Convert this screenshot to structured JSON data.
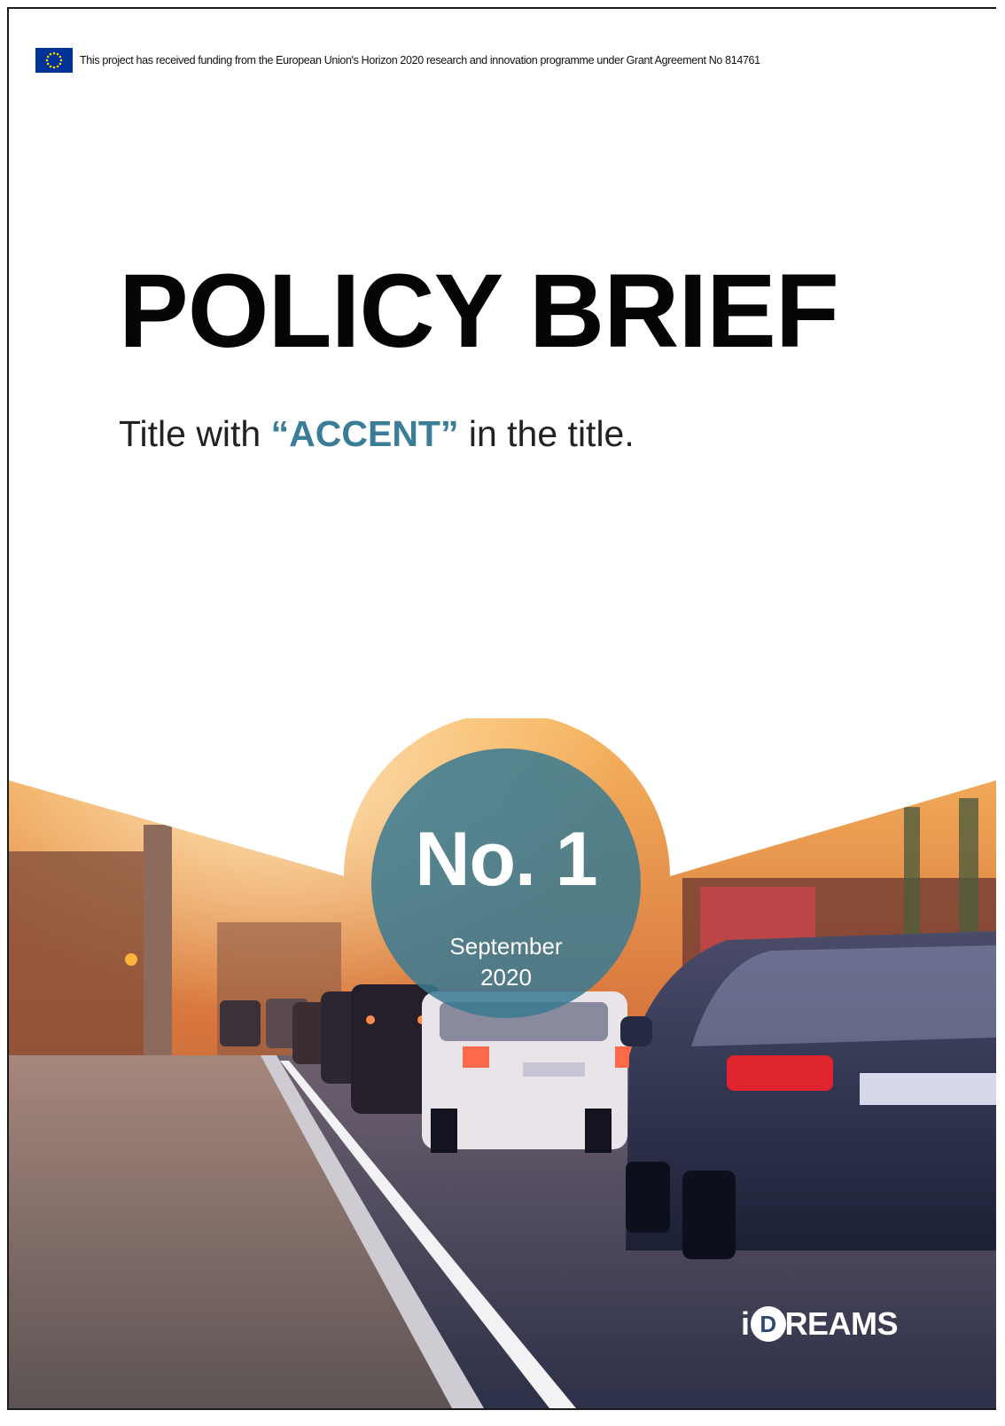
{
  "document": {
    "funding_notice": "This project has received funding from the European Union's Horizon 2020 research and innovation programme under Grant Agreement No 814761",
    "title": "POLICY BRIEF",
    "subtitle": {
      "before": "Title with ",
      "accent": "“ACCENT”",
      "after": " in the title."
    },
    "badge": {
      "number": "No. 1",
      "month": "September",
      "year": "2020"
    },
    "logo": {
      "i": "i",
      "d": "D",
      "rest": "REAMS"
    }
  },
  "colors": {
    "accent": "#3a7d96",
    "badge": "#3a7a92",
    "eu_blue": "#003399"
  }
}
